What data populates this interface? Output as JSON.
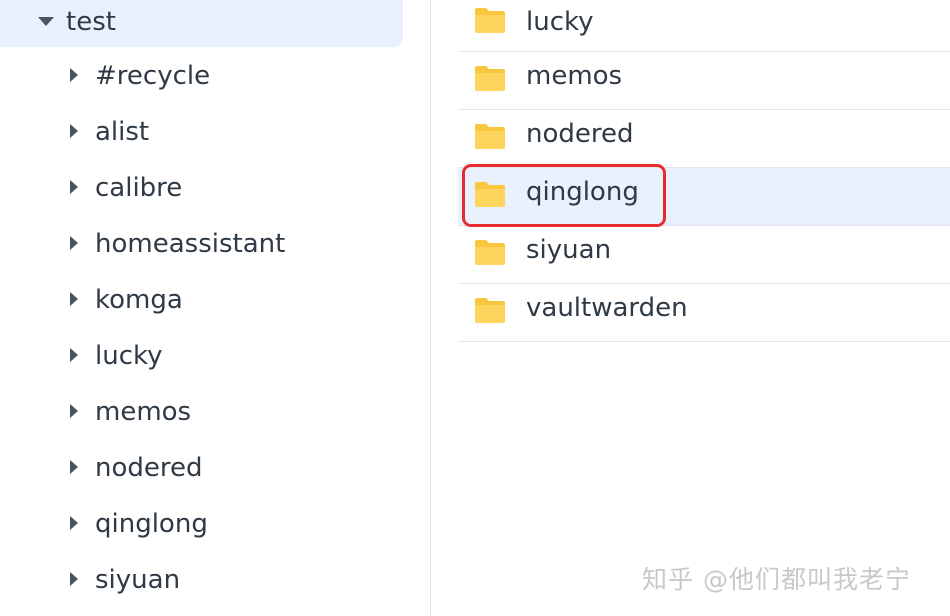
{
  "tree": {
    "root_label": "test",
    "items": [
      {
        "label": "#recycle"
      },
      {
        "label": "alist"
      },
      {
        "label": "calibre"
      },
      {
        "label": "homeassistant"
      },
      {
        "label": "komga"
      },
      {
        "label": "lucky"
      },
      {
        "label": "memos"
      },
      {
        "label": "nodered"
      },
      {
        "label": "qinglong"
      },
      {
        "label": "siyuan"
      }
    ]
  },
  "files": {
    "items": [
      {
        "name": "lucky"
      },
      {
        "name": "memos"
      },
      {
        "name": "nodered"
      },
      {
        "name": "qinglong",
        "selected": true
      },
      {
        "name": "siyuan"
      },
      {
        "name": "vaultwarden"
      }
    ]
  },
  "watermark": "知乎 @他们都叫我老宁",
  "colors": {
    "selection_bg": "#e8f1fd",
    "folder_yellow": "#f9c63d",
    "highlight_red": "#e52d2d",
    "text": "#2f3a45"
  }
}
